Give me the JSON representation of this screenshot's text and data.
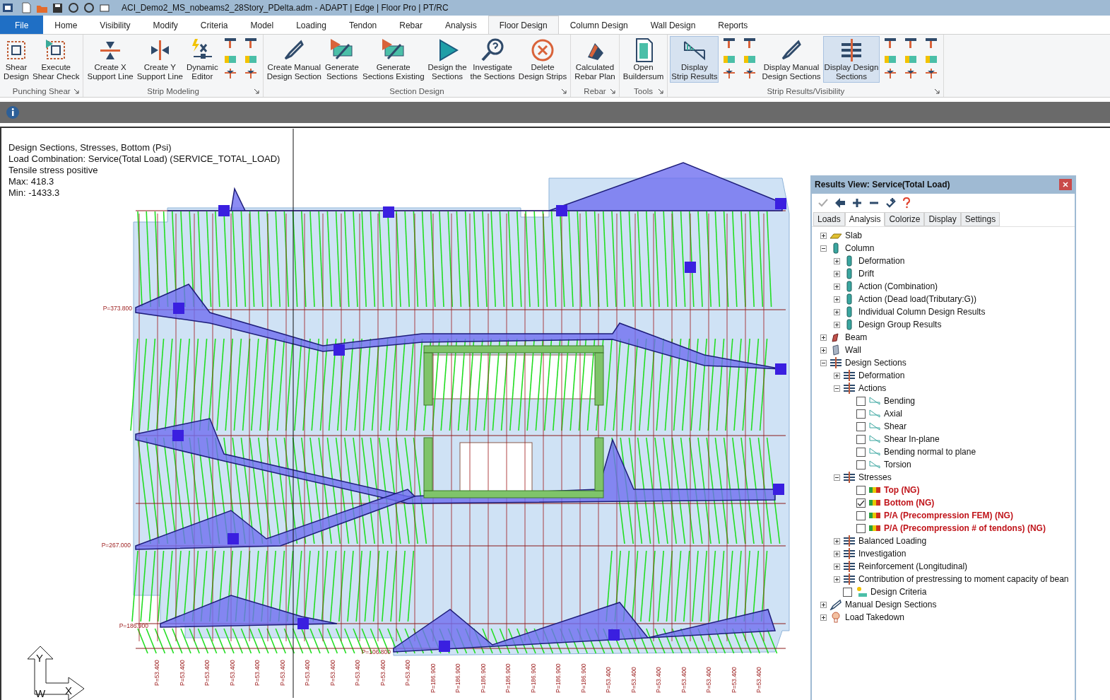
{
  "window": {
    "title": "ACI_Demo2_MS_nobeams2_28Story_PDelta.adm - ADAPT | Edge | Floor Pro | PT/RC"
  },
  "tabs": [
    {
      "label": "File",
      "kind": "file",
      "selected": false
    },
    {
      "label": "Home",
      "kind": "tab",
      "selected": false
    },
    {
      "label": "Visibility",
      "kind": "tab",
      "selected": false
    },
    {
      "label": "Modify",
      "kind": "tab",
      "selected": false
    },
    {
      "label": "Criteria",
      "kind": "tab",
      "selected": false
    },
    {
      "label": "Model",
      "kind": "tab",
      "selected": false
    },
    {
      "label": "Loading",
      "kind": "tab",
      "selected": false
    },
    {
      "label": "Tendon",
      "kind": "tab",
      "selected": false
    },
    {
      "label": "Rebar",
      "kind": "tab",
      "selected": false
    },
    {
      "label": "Analysis",
      "kind": "tab",
      "selected": false
    },
    {
      "label": "Floor Design",
      "kind": "tab",
      "selected": true
    },
    {
      "label": "Column Design",
      "kind": "tab",
      "selected": false
    },
    {
      "label": "Wall Design",
      "kind": "tab",
      "selected": false
    },
    {
      "label": "Reports",
      "kind": "tab",
      "selected": false
    }
  ],
  "ribbon": [
    {
      "label": "Punching Shear",
      "items": [
        {
          "kind": "large",
          "label": "Shear\nDesign",
          "selected": false
        },
        {
          "kind": "large",
          "label": "Execute\nShear Check",
          "selected": false
        }
      ]
    },
    {
      "label": "Strip Modeling",
      "items": [
        {
          "kind": "large",
          "label": "Create X\nSupport Line",
          "selected": false
        },
        {
          "kind": "large",
          "label": "Create Y\nSupport Line",
          "selected": false
        },
        {
          "kind": "large",
          "label": "Dynamic\nEditor",
          "selected": false
        },
        {
          "kind": "stack"
        },
        {
          "kind": "stack"
        }
      ]
    },
    {
      "label": "Section Design",
      "items": [
        {
          "kind": "large",
          "label": "Create Manual\nDesign Section",
          "selected": false
        },
        {
          "kind": "large",
          "label": "Generate\nSections",
          "selected": false
        },
        {
          "kind": "large",
          "label": "Generate\nSections Existing",
          "selected": false
        },
        {
          "kind": "large",
          "label": "Design the\nSections",
          "selected": false
        },
        {
          "kind": "large",
          "label": "Investigate\nthe Sections",
          "selected": false
        },
        {
          "kind": "large",
          "label": "Delete\nDesign Strips",
          "selected": false
        }
      ]
    },
    {
      "label": "Rebar",
      "items": [
        {
          "kind": "large",
          "label": "Calculated\nRebar Plan",
          "selected": false
        }
      ]
    },
    {
      "label": "Tools",
      "items": [
        {
          "kind": "large",
          "label": "Open\nBuildersum",
          "selected": false
        }
      ]
    },
    {
      "label": "Strip Results/Visibility",
      "items": [
        {
          "kind": "large",
          "label": "Display\nStrip Results",
          "selected": true
        },
        {
          "kind": "stack"
        },
        {
          "kind": "stack"
        },
        {
          "kind": "large",
          "label": "Display Manual\nDesign Sections",
          "selected": false
        },
        {
          "kind": "large",
          "label": "Display Design\nSections",
          "selected": true
        },
        {
          "kind": "stack"
        },
        {
          "kind": "stack"
        },
        {
          "kind": "stack"
        }
      ]
    }
  ],
  "canvas": {
    "info_lines": [
      "Design Sections, Stresses, Bottom (Psi)",
      "Load Combination: Service(Total Load) (SERVICE_TOTAL_LOAD)",
      "Tensile stress positive",
      "Max: 418.3",
      "Min: -1433.3"
    ],
    "side_labels": [
      "P=373.800",
      "P=267.000",
      "P=186.900",
      "P=106.800"
    ],
    "bottom_labels": [
      "P=53.400",
      "P=53.400",
      "P=53.400",
      "P=53.400",
      "P=53.400",
      "P=53.400",
      "P=53.400",
      "P=53.400",
      "P=53.400",
      "P=53.400",
      "P=53.400",
      "P=186.900",
      "P=186.900",
      "P=186.900",
      "P=186.900",
      "P=186.900",
      "P=186.900",
      "P=186.900",
      "P=53.400",
      "P=53.400",
      "P=53.400",
      "P=53.400",
      "P=53.400",
      "P=53.400",
      "P=53.400"
    ],
    "axes": {
      "y": "Y",
      "w": "W",
      "x": "X"
    }
  },
  "results_panel": {
    "title": "Results View: Service(Total Load)",
    "tabs": [
      {
        "label": "Loads",
        "selected": false
      },
      {
        "label": "Analysis",
        "selected": true
      },
      {
        "label": "Colorize",
        "selected": false
      },
      {
        "label": "Display",
        "selected": false
      },
      {
        "label": "Settings",
        "selected": false
      }
    ],
    "tree": [
      {
        "label": "Slab",
        "kind": "slab",
        "expanded": false
      },
      {
        "label": "Column",
        "kind": "column",
        "expanded": true,
        "children": [
          {
            "label": "Deformation",
            "kind": "column",
            "expanded": false
          },
          {
            "label": "Drift",
            "kind": "column",
            "expanded": false
          },
          {
            "label": "Action (Combination)",
            "kind": "column",
            "expanded": false
          },
          {
            "label": "Action (Dead load(Tributary:G))",
            "kind": "column",
            "expanded": false
          },
          {
            "label": "Individual Column Design Results",
            "kind": "column",
            "expanded": false
          },
          {
            "label": "Design Group Results",
            "kind": "column",
            "expanded": false
          }
        ]
      },
      {
        "label": "Beam",
        "kind": "beam",
        "expanded": false
      },
      {
        "label": "Wall",
        "kind": "wall",
        "expanded": false
      },
      {
        "label": "Design Sections",
        "kind": "sections",
        "expanded": true,
        "children": [
          {
            "label": "Deformation",
            "kind": "sections",
            "expanded": false
          },
          {
            "label": "Actions",
            "kind": "sections",
            "expanded": true,
            "children": [
              {
                "label": "Bending",
                "kind": "diagram",
                "checked": false
              },
              {
                "label": "Axial",
                "kind": "diagram",
                "checked": false
              },
              {
                "label": "Shear",
                "kind": "diagram",
                "checked": false
              },
              {
                "label": "Shear In-plane",
                "kind": "diagram",
                "checked": false
              },
              {
                "label": "Bending normal to plane",
                "kind": "diagram",
                "checked": false
              },
              {
                "label": "Torsion",
                "kind": "diagram",
                "checked": false
              }
            ]
          },
          {
            "label": "Stresses",
            "kind": "sections",
            "expanded": true,
            "children": [
              {
                "label": "Top (NG)",
                "kind": "stress",
                "checked": false,
                "error": true
              },
              {
                "label": "Bottom (NG)",
                "kind": "stress",
                "checked": true,
                "error": true
              },
              {
                "label": "P/A (Precompression FEM) (NG)",
                "kind": "stress",
                "checked": false,
                "error": true
              },
              {
                "label": "P/A (Precompression # of tendons) (NG)",
                "kind": "stress",
                "checked": false,
                "error": true
              }
            ]
          },
          {
            "label": "Balanced Loading",
            "kind": "sections",
            "expanded": false
          },
          {
            "label": "Investigation",
            "kind": "sections",
            "expanded": false
          },
          {
            "label": "Reinforcement (Longitudinal)",
            "kind": "sections",
            "expanded": false
          },
          {
            "label": "Contribution of prestressing to moment capacity of bean",
            "kind": "sections",
            "expanded": false
          },
          {
            "label": "Design Criteria",
            "kind": "criteria",
            "checked": false
          }
        ]
      },
      {
        "label": "Manual Design Sections",
        "kind": "manual",
        "expanded": false
      },
      {
        "label": "Load Takedown",
        "kind": "takedown",
        "expanded": false
      }
    ]
  }
}
